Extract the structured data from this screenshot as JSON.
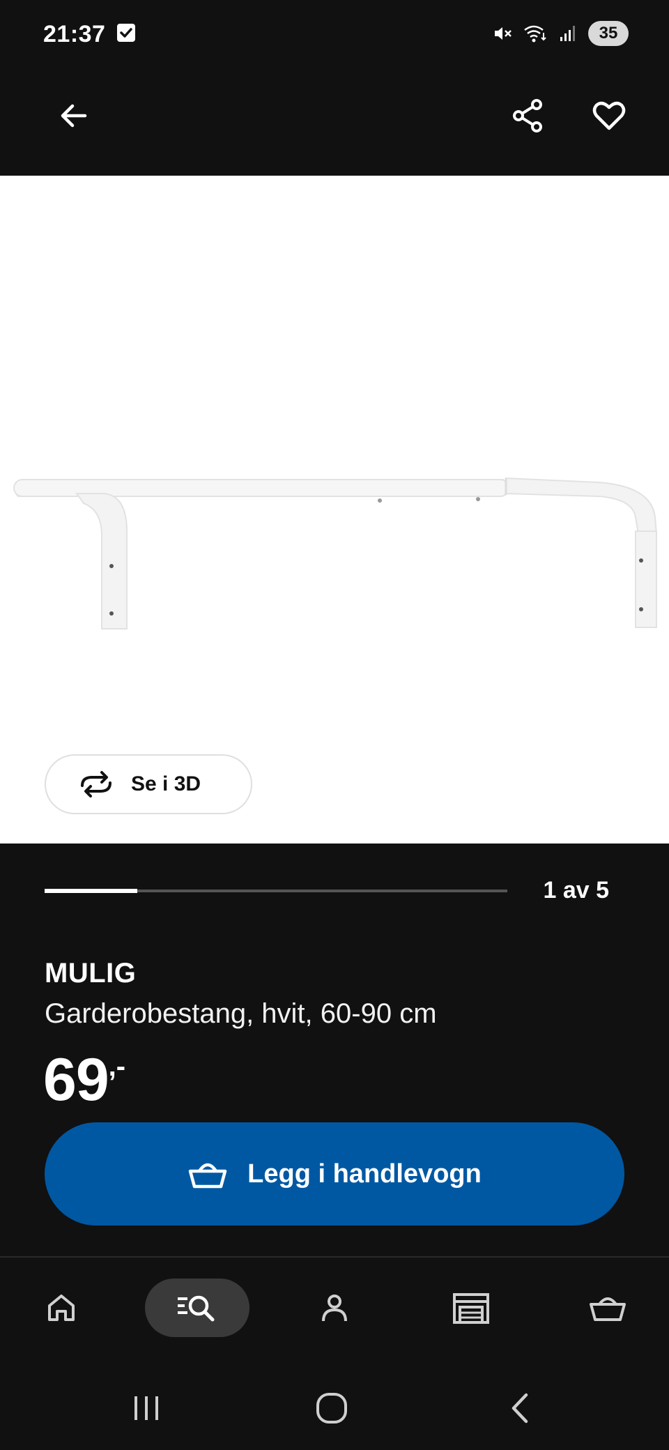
{
  "status_bar": {
    "time": "21:37",
    "battery": "35"
  },
  "app_bar": {
    "icons": [
      "back-arrow-icon",
      "share-icon",
      "heart-icon"
    ]
  },
  "gallery": {
    "view_3d_label": "Se i 3D",
    "counter": "1 av 5",
    "progress_fraction": 0.2
  },
  "product": {
    "name": "MULIG",
    "description": "Garderobestang, hvit, 60-90 cm",
    "price_integer": "69",
    "price_suffix": ",-"
  },
  "cart_button": {
    "label": "Legg i handlevogn",
    "color": "#0058a3"
  },
  "bottom_nav": {
    "items": [
      "home-icon",
      "search-icon",
      "profile-icon",
      "store-icon",
      "cart-icon"
    ],
    "active": "search-icon"
  },
  "system_nav": {
    "items": [
      "recents-icon",
      "home-circle-icon",
      "back-icon"
    ]
  }
}
